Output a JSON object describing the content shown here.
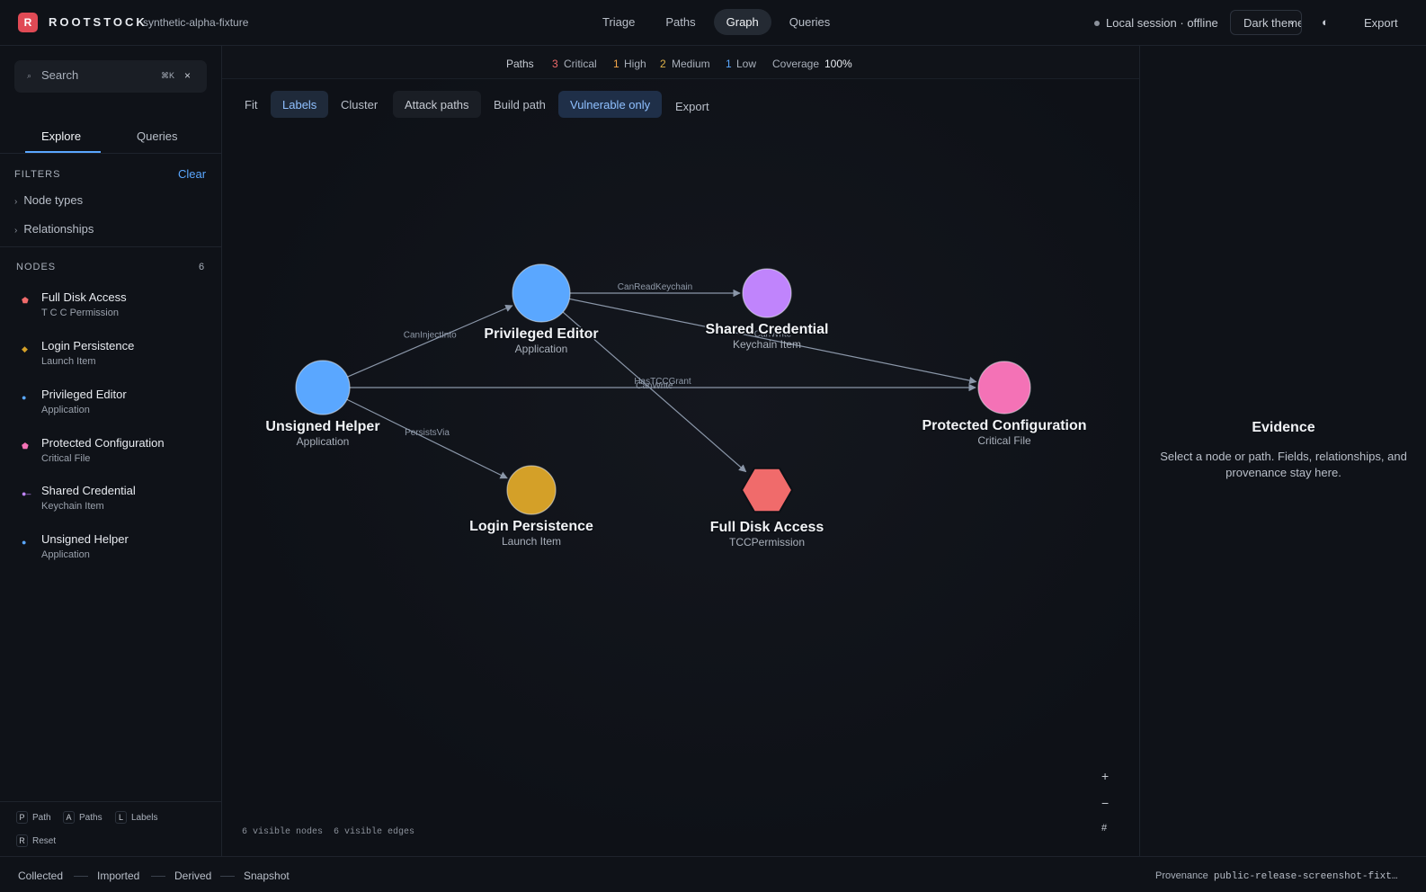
{
  "app": {
    "logo_letter": "R",
    "brand": "ROOTSTOCK",
    "fixture": "synthetic-alpha-fixture",
    "nav": [
      "Triage",
      "Paths",
      "Graph",
      "Queries"
    ],
    "active_nav": "Graph",
    "session": "Local session · offline",
    "theme": "Dark theme",
    "contrast_icon": "◐",
    "export": "Export"
  },
  "sidebar": {
    "search_placeholder": "Search",
    "search_kbd": "⌘K",
    "search_clear": "×",
    "tabs": [
      "Explore",
      "Queries"
    ],
    "filters_heading": "FILTERS",
    "clear": "Clear",
    "filters": [
      "Node types",
      "Relationships"
    ],
    "nodes_heading": "NODES",
    "nodes_count": "6",
    "nodes": [
      {
        "name": "Full Disk Access",
        "type": "T C C Permission",
        "color": "#f06b6b"
      },
      {
        "name": "Login Persistence",
        "type": "Launch Item",
        "color": "#d4a028"
      },
      {
        "name": "Privileged Editor",
        "type": "Application",
        "color": "#5aa7ff"
      },
      {
        "name": "Protected Configuration",
        "type": "Critical File",
        "color": "#f472b6"
      },
      {
        "name": "Shared Credential",
        "type": "Keychain Item",
        "color": "#c084fc"
      },
      {
        "name": "Unsigned Helper",
        "type": "Application",
        "color": "#5aa7ff"
      }
    ],
    "shortcuts": [
      {
        "key": "P",
        "label": "Path"
      },
      {
        "key": "A",
        "label": "Paths"
      },
      {
        "key": "L",
        "label": "Labels"
      },
      {
        "key": "R",
        "label": "Reset"
      }
    ]
  },
  "summary": {
    "paths_label": "Paths",
    "critical_count": "3",
    "critical_label": "Critical",
    "high_count": "1",
    "high_label": "High",
    "medium_count": "2",
    "medium_label": "Medium",
    "low_count": "1",
    "low_label": "Low",
    "coverage_label": "Coverage",
    "coverage_value": "100%"
  },
  "toolbar": [
    "Fit",
    "Labels",
    "Cluster",
    "Attack paths",
    "Build path",
    "Vulnerable only",
    "Export"
  ],
  "graph": {
    "nodes": [
      {
        "id": "unsigned",
        "label": "Unsigned Helper",
        "type": "Application",
        "color": "#5aa7ff",
        "shape": "circle"
      },
      {
        "id": "editor",
        "label": "Privileged Editor",
        "type": "Application",
        "color": "#5aa7ff",
        "shape": "circle"
      },
      {
        "id": "credential",
        "label": "Shared Credential",
        "type": "Keychain Item",
        "color": "#c084fc",
        "shape": "circle"
      },
      {
        "id": "config",
        "label": "Protected Configuration",
        "type": "Critical File",
        "color": "#f472b6",
        "shape": "circle"
      },
      {
        "id": "login",
        "label": "Login Persistence",
        "type": "Launch Item",
        "color": "#d4a028",
        "shape": "circle"
      },
      {
        "id": "fda",
        "label": "Full Disk Access",
        "type": "TCCPermission",
        "color": "#f06b6b",
        "shape": "hexagon"
      }
    ],
    "edges": [
      {
        "from": "unsigned",
        "to": "editor",
        "label": "CanInjectInto"
      },
      {
        "from": "editor",
        "to": "credential",
        "label": "CanReadKeychain"
      },
      {
        "from": "editor",
        "to": "config",
        "label": "CanWrite"
      },
      {
        "from": "unsigned",
        "to": "config",
        "label": "HasTCCGrant"
      },
      {
        "from": "unsigned",
        "to": "login",
        "label": "PersistsVia"
      },
      {
        "from": "editor",
        "to": "fda",
        "label": "CanWrite"
      }
    ],
    "edge_color": "#8a96a8",
    "zoom_controls": [
      "+",
      "−",
      "#"
    ],
    "visible_nodes": "6 visible nodes",
    "visible_edges": "6 visible edges"
  },
  "evidence": {
    "title": "Evidence",
    "body": "Select a node or path. Fields, relationships, and provenance stay here."
  },
  "footer": {
    "legend": [
      "Collected",
      "Imported",
      "Derived",
      "Snapshot"
    ],
    "provenance_label": "Provenance",
    "provenance_value": "public-release-screenshot-fixt…"
  }
}
